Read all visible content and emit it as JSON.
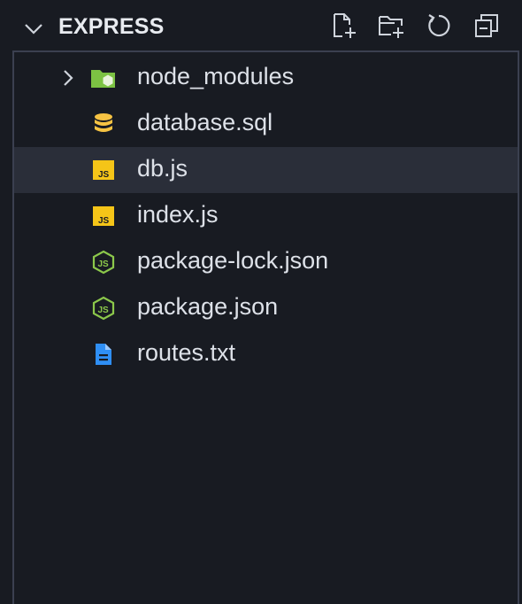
{
  "explorer": {
    "title": "EXPRESS",
    "actions": [
      {
        "name": "new-file-icon"
      },
      {
        "name": "new-folder-icon"
      },
      {
        "name": "refresh-icon"
      },
      {
        "name": "collapse-all-icon"
      }
    ]
  },
  "tree": {
    "items": [
      {
        "label": "node_modules",
        "icon": "folder-node-icon",
        "type": "folder",
        "expanded": false
      },
      {
        "label": "database.sql",
        "icon": "database-icon",
        "type": "file"
      },
      {
        "label": "db.js",
        "icon": "js-file-icon",
        "type": "file",
        "selected": true
      },
      {
        "label": "index.js",
        "icon": "js-file-icon",
        "type": "file"
      },
      {
        "label": "package-lock.json",
        "icon": "nodejs-icon",
        "type": "file"
      },
      {
        "label": "package.json",
        "icon": "nodejs-icon",
        "type": "file"
      },
      {
        "label": "routes.txt",
        "icon": "text-file-icon",
        "type": "file"
      }
    ]
  },
  "colors": {
    "background": "#181b22",
    "selected_row": "#2a2e39",
    "folder_green": "#7cc243",
    "database_yellow": "#f6c343",
    "js_yellow": "#f5c518",
    "nodejs_green": "#8cc84b",
    "text_file_blue": "#2f8ff5"
  }
}
